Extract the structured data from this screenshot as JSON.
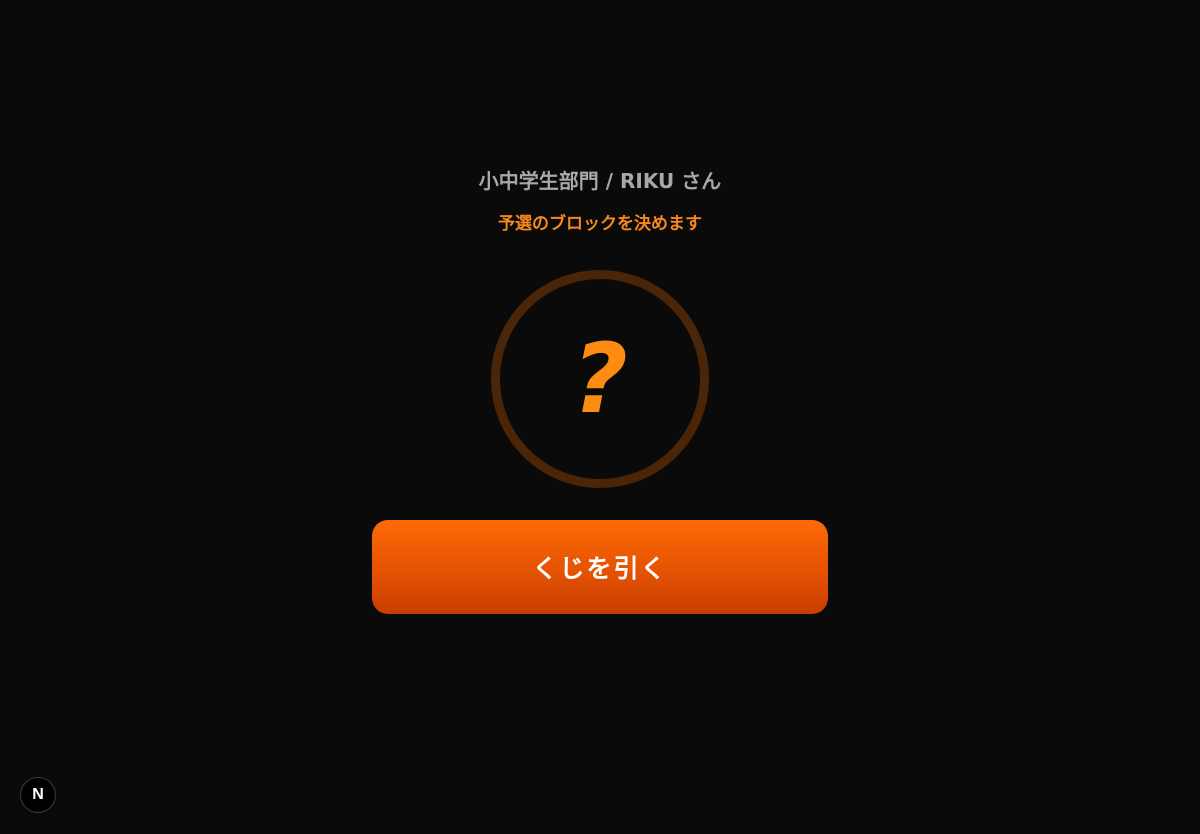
{
  "entrant": {
    "label": "小中学生部門 / RIKU さん"
  },
  "instruction": {
    "text": "予選のブロックを決めます"
  },
  "slot": {
    "placeholder": "?"
  },
  "actions": {
    "draw_label": "くじを引く"
  },
  "dev_badge": {
    "letter": "N"
  },
  "colors": {
    "background": "#0a0a0a",
    "accent": "#ff8c12",
    "button": "#e45203",
    "ring": "#4a2508"
  }
}
